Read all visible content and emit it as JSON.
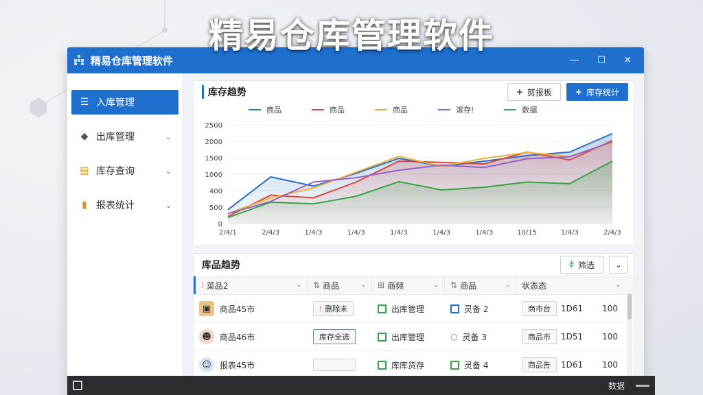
{
  "overlay_title": "精易仓库管理软件",
  "window": {
    "title": "精易仓库管理软件",
    "controls": [
      "—",
      "☐",
      "✕"
    ]
  },
  "sidebar": {
    "items": [
      {
        "label": "入库管理",
        "icon": "list-icon",
        "active": true
      },
      {
        "label": "出库管理",
        "icon": "box-icon",
        "active": false
      },
      {
        "label": "库存查询",
        "icon": "document-icon",
        "active": false
      },
      {
        "label": "报表统计",
        "icon": "bar-chart-icon",
        "active": false
      }
    ]
  },
  "chart_panel": {
    "title": "库存趋势",
    "btn_secondary": "剪报板",
    "btn_primary": "库存统计"
  },
  "chart_data": {
    "type": "area",
    "categories": [
      "2/4/1",
      "2/4/3",
      "1/4/3",
      "1/4/3",
      "1/4/3",
      "1/4/3",
      "1/4/3",
      "10/15",
      "1/4/3",
      "2/4/3"
    ],
    "series": [
      {
        "name": "商品",
        "color": "#2a6fc7",
        "values": [
          350,
          1180,
          950,
          1270,
          1650,
          1450,
          1580,
          1720,
          1810,
          2280
        ]
      },
      {
        "name": "商品",
        "color": "#d9473a",
        "values": [
          180,
          720,
          650,
          1050,
          1580,
          1550,
          1510,
          1810,
          1610,
          2100
        ]
      },
      {
        "name": "商品",
        "color": "#e8b13a",
        "values": [
          250,
          650,
          900,
          1300,
          1700,
          1450,
          1650,
          1800,
          1700,
          2050
        ]
      },
      {
        "name": "滚存!",
        "color": "#9a5ec7",
        "values": [
          250,
          560,
          1050,
          1160,
          1350,
          1480,
          1420,
          1640,
          1690,
          2070
        ]
      },
      {
        "name": "数据",
        "color": "#3aa14a",
        "values": [
          150,
          540,
          500,
          690,
          1060,
          850,
          920,
          1050,
          1010,
          1580
        ]
      }
    ],
    "y_ticks": [
      "2500",
      "2000",
      "1500",
      "1000",
      "400",
      "500",
      "0"
    ],
    "ylim": [
      0,
      2500
    ],
    "grid": true,
    "legend": "top"
  },
  "table_panel": {
    "title": "库品趋势",
    "btn_label": "筛选",
    "columns": [
      "菜品2",
      "商品",
      "商频",
      "商品",
      "状态态"
    ],
    "rows": [
      {
        "name": "商品45市",
        "avatar": "box-avatar",
        "tag": "删除未",
        "cat": "出库管理",
        "item": "灵备 2",
        "status": "商市台",
        "code": "1D61",
        "num": "100"
      },
      {
        "name": "商品46市",
        "avatar": "person-avatar",
        "tag": "库存全选",
        "cat": "出库管理",
        "item": "灵备 3",
        "status": "商品市",
        "code": "1D51",
        "num": "100"
      },
      {
        "name": "报表45市",
        "avatar": "person-avatar",
        "tag": "",
        "cat": "库库货存",
        "item": "灵备 4",
        "status": "商品告",
        "code": "1D61",
        "num": "100"
      }
    ]
  },
  "taskbar": {
    "right_label": "数据"
  }
}
